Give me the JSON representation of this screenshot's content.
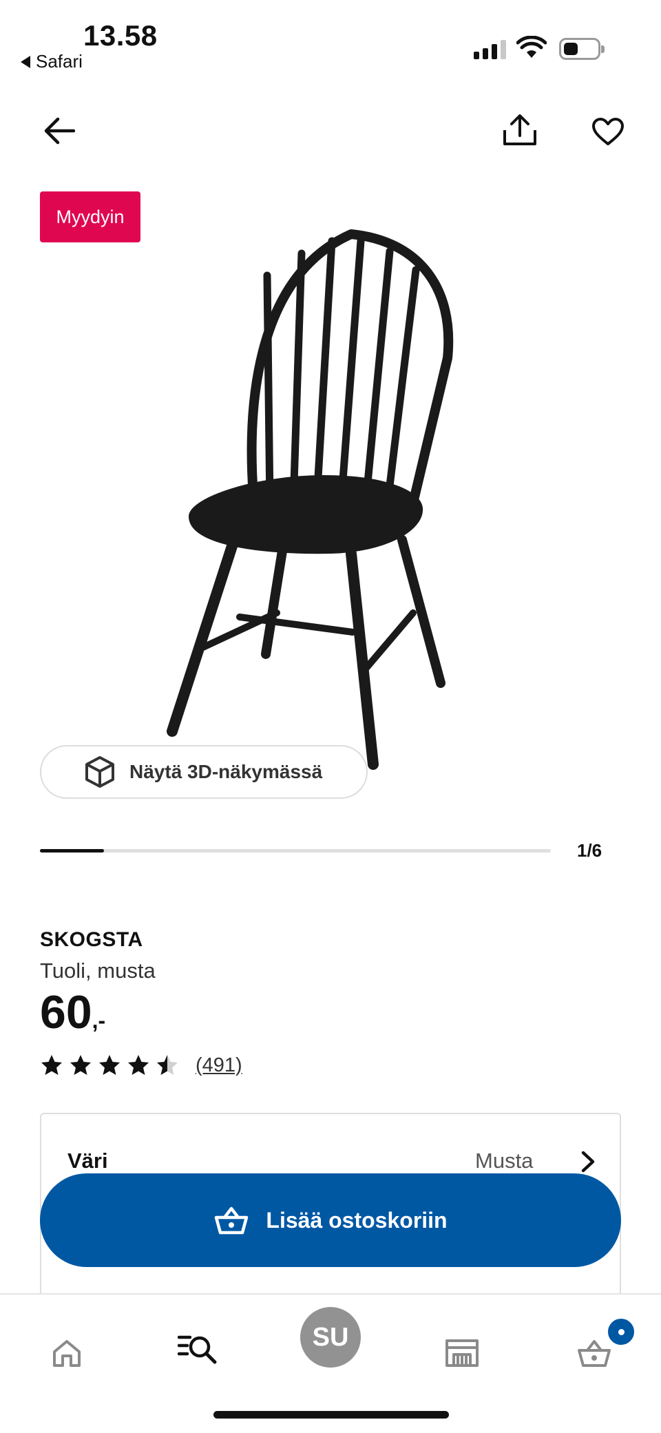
{
  "status_bar": {
    "time": "13.58",
    "back_app": "Safari"
  },
  "badge": {
    "label": "Myydyin"
  },
  "view_3d": {
    "label": "Näytä 3D-näkymässä"
  },
  "gallery": {
    "current": 1,
    "total": 6,
    "counter": "1/6",
    "progress_fraction": 0.125
  },
  "product": {
    "name": "SKOGSTA",
    "description": "Tuoli, musta",
    "price_main": "60",
    "price_suffix": ",-",
    "rating": 4.5,
    "rating_max": 5,
    "review_count": "(491)"
  },
  "variant": {
    "label": "Väri",
    "value": "Musta"
  },
  "add_to_cart": {
    "label": "Lisää ostoskoriin"
  },
  "tab_bar": {
    "avatar_initials": "SU",
    "items": [
      "home-icon",
      "search-list-icon",
      "avatar",
      "store-icon",
      "cart-icon"
    ]
  },
  "colors": {
    "brand_blue": "#0058a3",
    "badge_red": "#e00751",
    "avatar_gray": "#929292"
  }
}
